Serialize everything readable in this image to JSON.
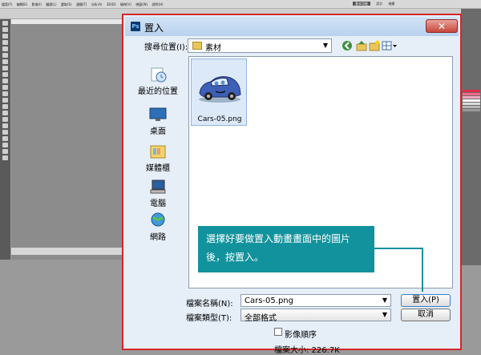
{
  "photoshop": {
    "menu": [
      "檔案(F)",
      "編輯(E)",
      "影像(I)",
      "圖層(L)",
      "選取(S)",
      "濾鏡(T)",
      "分析(A)",
      "3D(D)",
      "檢視(V)",
      "視窗(W)",
      "說明(H)"
    ],
    "workspace_tabs": [
      "基本功能",
      "設計",
      "繪畫"
    ],
    "swatch_colors": [
      "#e32b4a",
      "#f36b8a",
      "#f9a9c1",
      "#ffffff",
      "#dcdcdc",
      "#b7b7b7",
      "#9a9a9a"
    ]
  },
  "dialog": {
    "title": "置入",
    "close_label": "✕",
    "look_in_label": "搜尋位置(I):",
    "look_in_value": "素材",
    "places": [
      {
        "label": "最近的位置",
        "icon": "recent-places-icon"
      },
      {
        "label": "桌面",
        "icon": "desktop-icon"
      },
      {
        "label": "媒體櫃",
        "icon": "libraries-icon"
      },
      {
        "label": "電腦",
        "icon": "computer-icon"
      },
      {
        "label": "網路",
        "icon": "network-icon"
      }
    ],
    "files": [
      {
        "name": "Cars-05.png"
      }
    ],
    "file_name_label": "檔案名稱(N):",
    "file_name_value": "Cars-05.png",
    "file_type_label": "檔案類型(T):",
    "file_type_value": "全部格式",
    "place_button": "置入(P)",
    "cancel_button": "取消",
    "image_sequence_label": "影像順序",
    "file_size_label": "檔案大小: 226.7K"
  },
  "callout": {
    "line1": "選擇好要做置入動畫畫面中的圖片",
    "line2": "後，按置入。"
  },
  "colors": {
    "highlight_border": "#d4262c",
    "callout_bg": "#12929c",
    "dialog_bg": "#e6eef7"
  }
}
